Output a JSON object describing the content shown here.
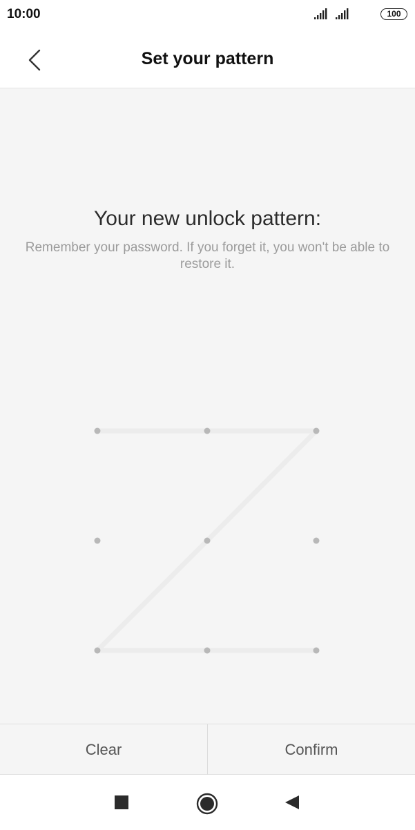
{
  "status_bar": {
    "time": "10:00",
    "battery": "100",
    "icons": [
      "signal-icon",
      "signal-icon",
      "battery-icon"
    ]
  },
  "header": {
    "title": "Set your pattern",
    "back_icon": "chevron-left-icon"
  },
  "main": {
    "heading": "Your new unlock pattern:",
    "subtext": "Remember your password. If you forget it, you won't be able to restore it."
  },
  "pattern": {
    "grid_size": 3,
    "selected_sequence": [
      1,
      2,
      3,
      5,
      7,
      8,
      9
    ],
    "dot_color": "#b8b8b8",
    "line_color": "#ececec"
  },
  "actions": {
    "clear_label": "Clear",
    "confirm_label": "Confirm"
  },
  "nav_bar": {
    "icons": [
      "square-recents-icon",
      "circle-home-icon",
      "triangle-back-icon"
    ]
  },
  "colors": {
    "content_bg": "#f5f5f5",
    "title_text": "#111111",
    "subtext": "#9b9b9b"
  }
}
